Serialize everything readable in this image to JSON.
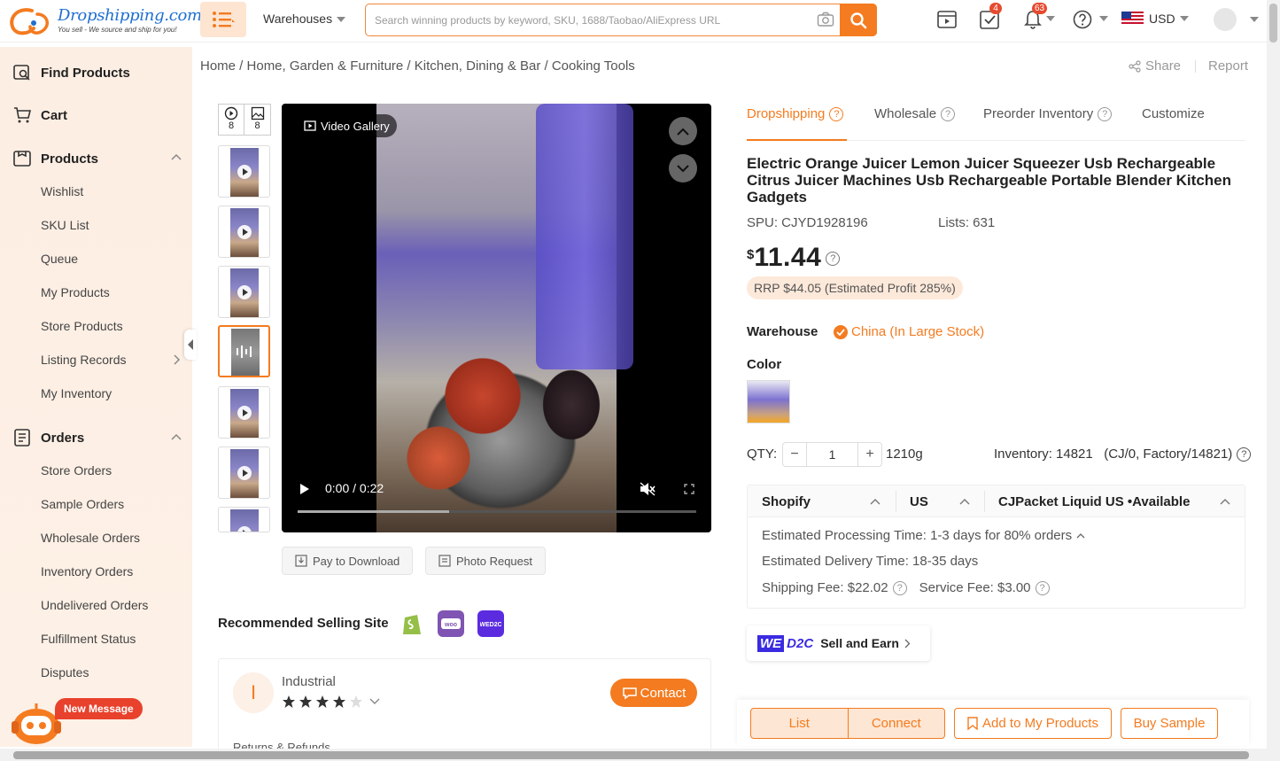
{
  "header": {
    "logo_text": "Dropshipping.com",
    "logo_tagline": "You sell - We source and ship for you!",
    "warehouses_label": "Warehouses",
    "search_placeholder": "Search winning products by keyword, SKU, 1688/Taobao/AliExpress URL",
    "tasks_badge": "4",
    "notifications_badge": "63",
    "currency": "USD"
  },
  "sidebar": {
    "find_products": "Find Products",
    "cart": "Cart",
    "products": "Products",
    "product_items": [
      "Wishlist",
      "SKU List",
      "Queue",
      "My Products",
      "Store Products",
      "Listing Records",
      "My Inventory"
    ],
    "orders": "Orders",
    "order_items": [
      "Store Orders",
      "Sample Orders",
      "Wholesale Orders",
      "Inventory Orders",
      "Undelivered Orders",
      "Fulfillment Status",
      "Disputes"
    ]
  },
  "breadcrumb": "Home / Home, Garden & Furniture / Kitchen, Dining & Bar / Cooking Tools",
  "share_label": "Share",
  "report_label": "Report",
  "gallery": {
    "video_count": "8",
    "image_count": "8",
    "video_gallery_label": "Video Gallery",
    "time_display": "0:00 / 0:22",
    "progress": 0.38
  },
  "actions": {
    "pay_to_download": "Pay to Download",
    "photo_request": "Photo Request"
  },
  "recommended_label": "Recommended Selling Site",
  "recommended_sites": [
    {
      "name": "shopify-icon",
      "color": "#95bf47"
    },
    {
      "name": "woo-icon",
      "color": "#7f54b3"
    },
    {
      "name": "wed2c-icon",
      "color": "#5b2be0"
    }
  ],
  "supplier": {
    "initial": "I",
    "name": "Industrial",
    "rating": 4,
    "contact_label": "Contact",
    "returns_label": "Returns & Refunds"
  },
  "tabs": {
    "dropshipping": "Dropshipping",
    "wholesale": "Wholesale",
    "preorder": "Preorder Inventory",
    "customize": "Customize"
  },
  "product": {
    "title": "Electric Orange Juicer Lemon Juicer Squeezer Usb Rechargeable Citrus Juicer Machines Usb Rechargeable Portable Blender Kitchen Gadgets",
    "spu": "SPU: CJYD1928196",
    "lists": "Lists: 631",
    "currency_symbol": "$",
    "price": "11.44",
    "rrp": "RRP $44.05 (Estimated Profit 285%)",
    "warehouse_label": "Warehouse",
    "warehouse_value": "China (In Large Stock)",
    "color_label": "Color",
    "qty_label": "QTY:",
    "qty_value": "1",
    "weight": "1210g",
    "inventory": "Inventory: 14821   (CJ/0, Factory/14821)"
  },
  "shipping": {
    "platform": "Shopify",
    "country": "US",
    "method": "CJPacket Liquid US",
    "availability": "•Available",
    "processing": "Estimated Processing Time: 1-3 days for 80% orders",
    "delivery": "Estimated Delivery Time: 18-35 days",
    "shipping_fee": "Shipping Fee: $22.02",
    "service_fee": "Service Fee: $3.00"
  },
  "wed2c": {
    "we": "WE",
    "d2c": "D2C",
    "label": "Sell and Earn"
  },
  "bottom_actions": {
    "list": "List",
    "connect": "Connect",
    "add_to_my_products": "Add to My Products",
    "buy_sample": "Buy Sample"
  },
  "new_message_label": "New Message",
  "colors": {
    "accent": "#f47b20",
    "brand_blue": "#1f6fd1",
    "badge_red": "#e64a2e"
  }
}
